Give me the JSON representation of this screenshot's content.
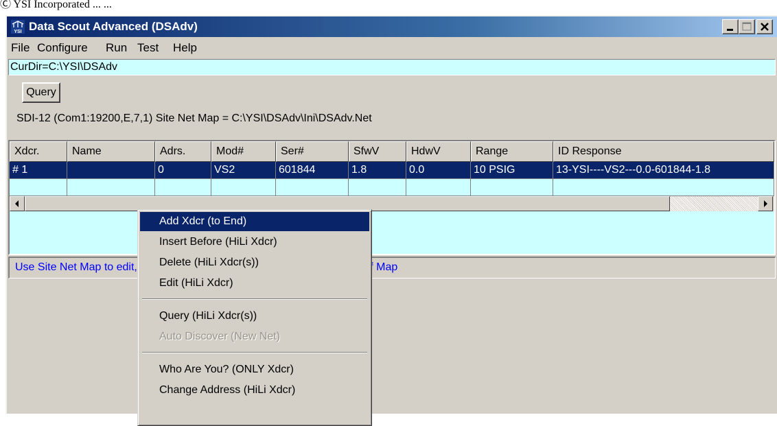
{
  "caption": "Ⓒ YSI Incorporated ... ...",
  "window": {
    "title": "Data Scout Advanced (DSAdv)",
    "icon": "ysi-icon"
  },
  "menu": [
    "File",
    "Configure",
    "Run",
    "Test",
    "Help"
  ],
  "curdir": "CurDir=C:\\YSI\\DSAdv",
  "query_button": "Query",
  "sdi_line": "SDI-12 (Com1:19200,E,7,1) Site Net Map = C:\\YSI\\DSAdv\\Ini\\DSAdv.Net",
  "table": {
    "columns": [
      "Xdcr.",
      "Name",
      "Adrs.",
      "Mod#",
      "Ser#",
      "SfwV",
      "HdwV",
      "Range",
      "ID Response"
    ],
    "rows": [
      [
        "# 1",
        "",
        "0",
        "VS2",
        "601844",
        "1.8",
        "0.0",
        "10 PSIG",
        "13-YSI----VS2---0.0-601844-1.8"
      ]
    ]
  },
  "status": "Use Site Net Map to edit, query, or change the (selected) xducer row(s) of Map",
  "context_menu": {
    "items": [
      {
        "label": "Add Xdcr (to End)",
        "state": "active"
      },
      {
        "label": "Insert Before (HiLi Xdcr)",
        "state": "enabled"
      },
      {
        "label": "Delete (HiLi Xdcr(s))",
        "state": "enabled"
      },
      {
        "label": "Edit (HiLi Xdcr)",
        "state": "enabled"
      },
      {
        "label": "Query (HiLi Xdcr(s))",
        "state": "enabled"
      },
      {
        "label": "Auto Discover (New Net)",
        "state": "disabled"
      },
      {
        "label": "Who Are You?  (ONLY Xdcr)",
        "state": "enabled"
      },
      {
        "label": "Change Address (HiLi Xdcr)",
        "state": "enabled"
      }
    ]
  },
  "colors": {
    "title_gradient_start": "#0a246a",
    "cyan_field": "#ccffff",
    "status_text": "#0000ff"
  }
}
